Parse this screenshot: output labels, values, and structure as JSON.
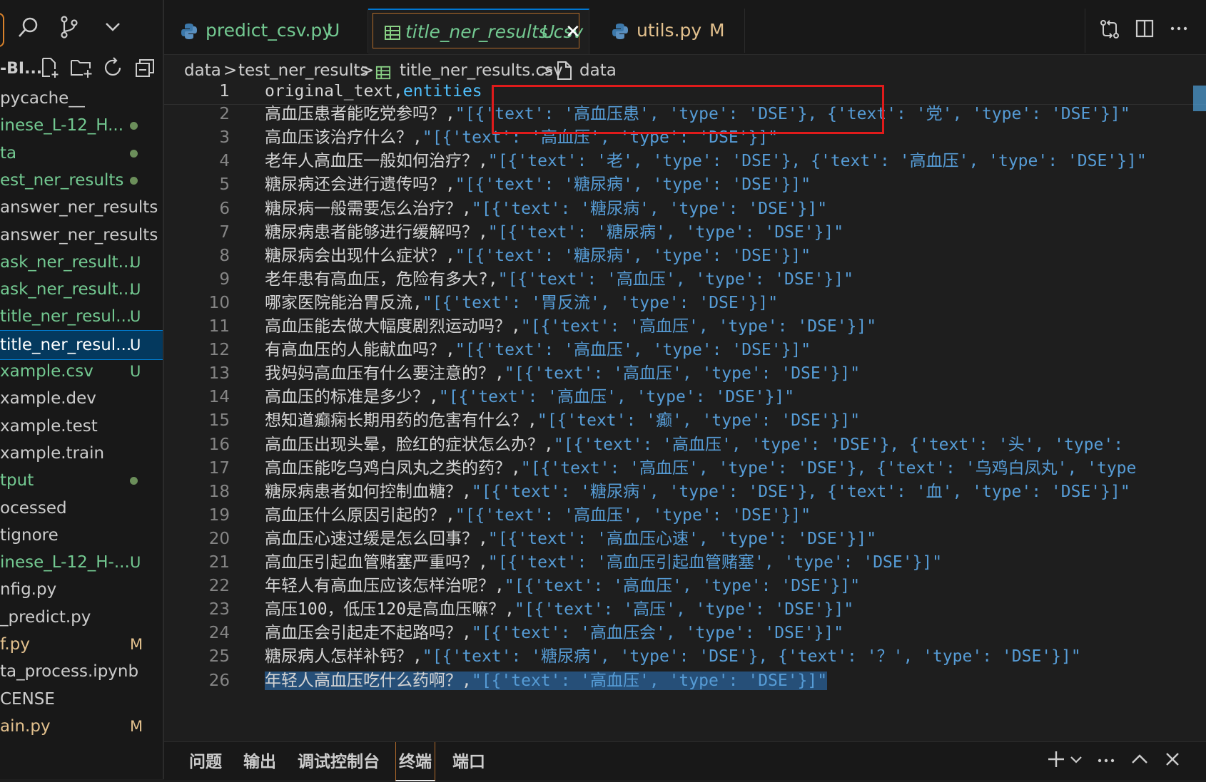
{
  "sidebar": {
    "explorer_title": "-BI...",
    "activity_icons": [
      "search-icon",
      "source-control-icon",
      "chevron-down-icon"
    ],
    "toolbar_icons": [
      "new-file-icon",
      "new-folder-icon",
      "refresh-icon",
      "collapse-all-icon"
    ],
    "items": [
      {
        "label": "pycache__",
        "status": "",
        "dot": false,
        "color": "#cccccc"
      },
      {
        "label": "inese_L-12_H...",
        "status": "",
        "dot": true,
        "color": "#73c991"
      },
      {
        "label": "ta",
        "status": "",
        "dot": true,
        "color": "#73c991"
      },
      {
        "label": "est_ner_results",
        "status": "",
        "dot": true,
        "color": "#73c991"
      },
      {
        "label": " answer_ner_results...",
        "status": "",
        "dot": false,
        "color": "#cccccc"
      },
      {
        "label": " answer_ner_results....",
        "status": "",
        "dot": false,
        "color": "#cccccc"
      },
      {
        "label": " ask_ner_result...",
        "status": "U",
        "dot": false,
        "color": "#73c991"
      },
      {
        "label": " ask_ner_result...",
        "status": "U",
        "dot": false,
        "color": "#73c991"
      },
      {
        "label": " title_ner_resul...",
        "status": "U",
        "dot": false,
        "color": "#73c991"
      },
      {
        "label": " title_ner_resul...",
        "status": "U",
        "dot": false,
        "color": "#ffffff",
        "selected": true
      },
      {
        "label": "xample.csv",
        "status": "U",
        "dot": false,
        "color": "#73c991"
      },
      {
        "label": "xample.dev",
        "status": "",
        "dot": false,
        "color": "#cccccc"
      },
      {
        "label": "xample.test",
        "status": "",
        "dot": false,
        "color": "#cccccc"
      },
      {
        "label": "xample.train",
        "status": "",
        "dot": false,
        "color": "#cccccc"
      },
      {
        "label": "tput",
        "status": "",
        "dot": true,
        "color": "#73c991"
      },
      {
        "label": "ocessed",
        "status": "",
        "dot": false,
        "color": "#cccccc"
      },
      {
        "label": "tignore",
        "status": "",
        "dot": false,
        "color": "#cccccc"
      },
      {
        "label": "inese_L-12_H-...",
        "status": "U",
        "dot": false,
        "color": "#73c991"
      },
      {
        "label": "nfig.py",
        "status": "",
        "dot": false,
        "color": "#cccccc"
      },
      {
        "label": "_predict.py",
        "status": "",
        "dot": false,
        "color": "#cccccc"
      },
      {
        "label": "f.py",
        "status": "M",
        "dot": false,
        "color": "#e2c08d"
      },
      {
        "label": "ta_process.ipynb",
        "status": "",
        "dot": false,
        "color": "#cccccc"
      },
      {
        "label": "CENSE",
        "status": "",
        "dot": false,
        "color": "#cccccc"
      },
      {
        "label": "ain.py",
        "status": "M",
        "dot": false,
        "color": "#e2c08d"
      }
    ]
  },
  "tabs": [
    {
      "name": "predict_csv.py",
      "status": "U",
      "icon": "python-icon",
      "color": "#73c991",
      "active": false
    },
    {
      "name": "title_ner_results.csv",
      "status": "U",
      "icon": "csv-table-icon",
      "color": "#73c991",
      "active": true,
      "close": "✕"
    },
    {
      "name": "utils.py",
      "status": "M",
      "icon": "python-icon",
      "color": "#e2c08d",
      "active": false
    }
  ],
  "editor_actions": [
    "compare-changes-icon",
    "split-editor-icon",
    "more-actions-icon"
  ],
  "breadcrumb": {
    "parts": [
      "data",
      "test_ner_results",
      "title_ner_results.csv",
      "data"
    ],
    "separator": ">"
  },
  "editor": {
    "current_line": 1,
    "lines": [
      {
        "n": "1",
        "text": "original_text,",
        "str": "entities"
      },
      {
        "n": "2",
        "text": "高血压患者能吃党参吗？,",
        "str": "\"[{'text': '高血压患', 'type': 'DSE'}, {'text': '党', 'type': 'DSE'}]\""
      },
      {
        "n": "3",
        "text": "高血压该治疗什么？,",
        "str": "\"[{'text': '高血压', 'type': 'DSE'}]\""
      },
      {
        "n": "4",
        "text": "老年人高血压一般如何治疗？,",
        "str": "\"[{'text': '老', 'type': 'DSE'}, {'text': '高血压', 'type': 'DSE'}]\""
      },
      {
        "n": "5",
        "text": "糖尿病还会进行遗传吗？,",
        "str": "\"[{'text': '糖尿病', 'type': 'DSE'}]\""
      },
      {
        "n": "6",
        "text": "糖尿病一般需要怎么治疗？,",
        "str": "\"[{'text': '糖尿病', 'type': 'DSE'}]\""
      },
      {
        "n": "7",
        "text": "糖尿病患者能够进行缓解吗？,",
        "str": "\"[{'text': '糖尿病', 'type': 'DSE'}]\""
      },
      {
        "n": "8",
        "text": "糖尿病会出现什么症状？,",
        "str": "\"[{'text': '糖尿病', 'type': 'DSE'}]\""
      },
      {
        "n": "9",
        "text": "老年患有高血压，危险有多大?,",
        "str": "\"[{'text': '高血压', 'type': 'DSE'}]\""
      },
      {
        "n": "10",
        "text": "哪家医院能治胃反流,",
        "str": "\"[{'text': '胃反流', 'type': 'DSE'}]\""
      },
      {
        "n": "11",
        "text": "高血压能去做大幅度剧烈运动吗？,",
        "str": "\"[{'text': '高血压', 'type': 'DSE'}]\""
      },
      {
        "n": "12",
        "text": "有高血压的人能献血吗？,",
        "str": "\"[{'text': '高血压', 'type': 'DSE'}]\""
      },
      {
        "n": "13",
        "text": "我妈妈高血压有什么要注意的？,",
        "str": "\"[{'text': '高血压', 'type': 'DSE'}]\""
      },
      {
        "n": "14",
        "text": "高血压的标准是多少？,",
        "str": "\"[{'text': '高血压', 'type': 'DSE'}]\""
      },
      {
        "n": "15",
        "text": "想知道癫痫长期用药的危害有什么？,",
        "str": "\"[{'text': '癫', 'type': 'DSE'}]\""
      },
      {
        "n": "16",
        "text": "高血压出现头晕，脸红的症状怎么办？,",
        "str": "\"[{'text': '高血压', 'type': 'DSE'}, {'text': '头', 'type':"
      },
      {
        "n": "17",
        "text": "高血压能吃乌鸡白凤丸之类的药？,",
        "str": "\"[{'text': '高血压', 'type': 'DSE'}, {'text': '乌鸡白凤丸', 'type"
      },
      {
        "n": "18",
        "text": "糖尿病患者如何控制血糖？,",
        "str": "\"[{'text': '糖尿病', 'type': 'DSE'}, {'text': '血', 'type': 'DSE'}]\""
      },
      {
        "n": "19",
        "text": "高血压什么原因引起的？,",
        "str": "\"[{'text': '高血压', 'type': 'DSE'}]\""
      },
      {
        "n": "20",
        "text": "高血压心速过缓是怎么回事？,",
        "str": "\"[{'text': '高血压心速', 'type': 'DSE'}]\""
      },
      {
        "n": "21",
        "text": "高血压引起血管赌塞严重吗？,",
        "str": "\"[{'text': '高血压引起血管赌塞', 'type': 'DSE'}]\""
      },
      {
        "n": "22",
        "text": "年轻人有高血压应该怎样治呢？,",
        "str": "\"[{'text': '高血压', 'type': 'DSE'}]\""
      },
      {
        "n": "23",
        "text": "高压100，低压120是高血压嘛？,",
        "str": "\"[{'text': '高压', 'type': 'DSE'}]\""
      },
      {
        "n": "24",
        "text": "高血压会引起走不起路吗？,",
        "str": "\"[{'text': '高血压会', 'type': 'DSE'}]\""
      },
      {
        "n": "25",
        "text": "糖尿病人怎样补钙？,",
        "str": "\"[{'text': '糖尿病', 'type': 'DSE'}, {'text': '？', 'type': 'DSE'}]\""
      },
      {
        "n": "26",
        "text": "年轻人高血压吃什么药啊？,",
        "str": "\"[{'text': '高血压', 'type': 'DSE'}]\"",
        "selected": true
      }
    ]
  },
  "panel": {
    "tabs": [
      "问题",
      "输出",
      "调试控制台",
      "终端",
      "端口"
    ],
    "active": "终端",
    "actions": [
      "plus-icon",
      "chevron-down-icon",
      "more-icon",
      "chevron-up-icon",
      "close-icon"
    ]
  }
}
